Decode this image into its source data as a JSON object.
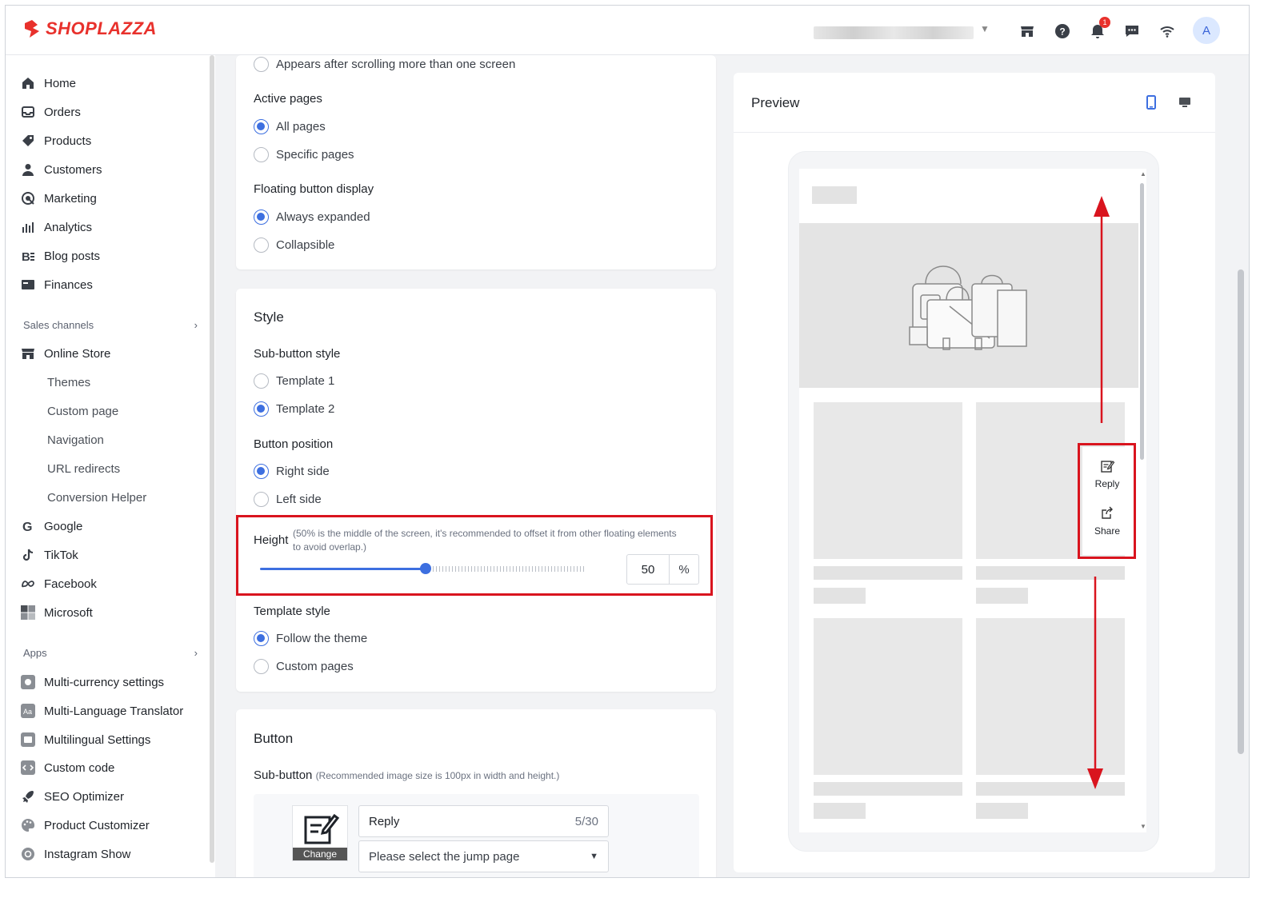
{
  "brand": {
    "name": "SHOPLAZZA",
    "color": "#e8312c"
  },
  "header": {
    "icons": [
      "store-icon",
      "help-icon",
      "bell-icon",
      "chat-icon",
      "wifi-icon"
    ],
    "notification_count": "1",
    "avatar_initial": "A"
  },
  "sidebar": {
    "items": [
      {
        "label": "Home",
        "icon": "home-icon"
      },
      {
        "label": "Orders",
        "icon": "orders-icon"
      },
      {
        "label": "Products",
        "icon": "tag-icon"
      },
      {
        "label": "Customers",
        "icon": "person-icon"
      },
      {
        "label": "Marketing",
        "icon": "marketing-icon"
      },
      {
        "label": "Analytics",
        "icon": "analytics-icon"
      },
      {
        "label": "Blog posts",
        "icon": "blog-icon"
      },
      {
        "label": "Finances",
        "icon": "finances-icon"
      }
    ],
    "sales_channels_label": "Sales channels",
    "online_store_label": "Online Store",
    "online_store_sub": [
      "Themes",
      "Custom page",
      "Navigation",
      "URL redirects",
      "Conversion Helper"
    ],
    "channels": [
      "Google",
      "TikTok",
      "Facebook",
      "Microsoft"
    ],
    "apps_label": "Apps",
    "apps": [
      "Multi-currency settings",
      "Multi-Language Translator",
      "Multilingual Settings",
      "Custom code",
      "SEO Optimizer",
      "Product Customizer",
      "Instagram Show"
    ]
  },
  "display": {
    "scroll_option": "Appears after scrolling more than one screen",
    "active_pages_label": "Active pages",
    "active_pages_options": [
      "All pages",
      "Specific pages"
    ],
    "floating_label": "Floating button display",
    "floating_options": [
      "Always expanded",
      "Collapsible"
    ]
  },
  "style": {
    "title": "Style",
    "sub_button_style_label": "Sub-button style",
    "sub_button_options": [
      "Template 1",
      "Template 2"
    ],
    "position_label": "Button position",
    "position_options": [
      "Right side",
      "Left side"
    ],
    "height_label": "Height",
    "height_hint": "(50% is the middle of the screen, it's recommended to offset it from other floating elements to avoid overlap.)",
    "height_value": "50",
    "height_unit": "%",
    "height_level": 0.5,
    "template_style_label": "Template style",
    "template_style_options": [
      "Follow the theme",
      "Custom pages"
    ]
  },
  "button": {
    "title": "Button",
    "sub_button_label": "Sub-button",
    "sub_button_hint": "(Recommended image size is 100px in width and height.)",
    "change_label": "Change",
    "name_value": "Reply",
    "name_count": "5/30",
    "jump_placeholder": "Please select the jump page"
  },
  "preview": {
    "title": "Preview",
    "floating_buttons": [
      {
        "label": "Reply",
        "icon": "reply-icon"
      },
      {
        "label": "Share",
        "icon": "share-icon"
      }
    ]
  },
  "colors": {
    "accent": "#3d6fe0",
    "highlight": "#d9141e"
  }
}
